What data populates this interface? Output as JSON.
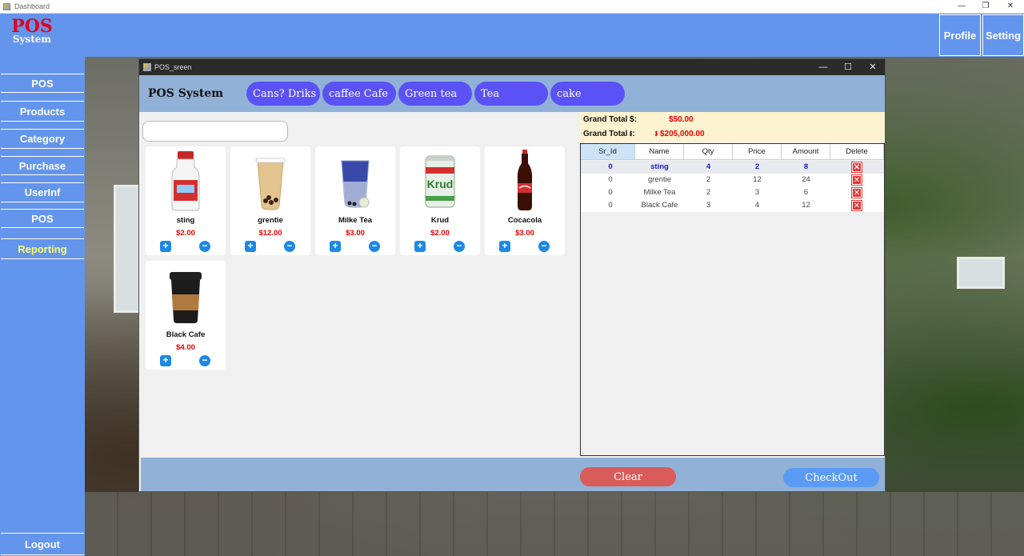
{
  "window": {
    "title": "Dashboard",
    "minimize": "—",
    "restore": "❐",
    "close": "✕"
  },
  "brand": {
    "title": "POS",
    "subtitle": "System"
  },
  "header": {
    "profile": "Profile",
    "setting": "Setting"
  },
  "sidebar": {
    "items": [
      "POS",
      "Products",
      "Category",
      "Purchase",
      "UserInf",
      "POS",
      "Reporting"
    ],
    "logout": "Logout"
  },
  "pos_window": {
    "title": "POS_sreen",
    "minimize": "—",
    "maximize": "☐",
    "close": "✕",
    "heading": "POS System"
  },
  "categories": [
    "Cans? Driks",
    "caffee Cafe",
    "Green tea",
    "Tea",
    "cake"
  ],
  "search": {
    "placeholder": "",
    "value": ""
  },
  "products": [
    {
      "name": "sting",
      "price": "$2.00",
      "icon": "milk-bottle-icon"
    },
    {
      "name": "grentie",
      "price": "$12.00",
      "icon": "bubble-tea-icon"
    },
    {
      "name": "Milke Tea",
      "price": "$3.00",
      "icon": "butterfly-pea-tea-icon"
    },
    {
      "name": "Krud",
      "price": "$2.00",
      "icon": "krud-can-icon"
    },
    {
      "name": "Cocacola",
      "price": "$3.00",
      "icon": "cola-bottle-icon"
    },
    {
      "name": "Black Cafe",
      "price": "$4.00",
      "icon": "coffee-cup-icon"
    }
  ],
  "totals": {
    "usd_label": "Grand Total $:",
    "usd_value": "$50.00",
    "riel_label": "Grand Total ៛:",
    "riel_value": "៛ $205,000.00"
  },
  "cart": {
    "columns": [
      "Sr_Id",
      "Name",
      "Qty",
      "Price",
      "Amount",
      "Delete"
    ],
    "rows": [
      {
        "id": "0",
        "name": "sting",
        "qty": "4",
        "price": "2",
        "amount": "8"
      },
      {
        "id": "0",
        "name": "grentie",
        "qty": "2",
        "price": "12",
        "amount": "24"
      },
      {
        "id": "0",
        "name": "Milke Tea",
        "qty": "2",
        "price": "3",
        "amount": "6"
      },
      {
        "id": "0",
        "name": "Black Cafe",
        "qty": "3",
        "price": "4",
        "amount": "12"
      }
    ],
    "delete_glyph": "✕"
  },
  "actions": {
    "clear": "Clear",
    "checkout": "CheckOut"
  },
  "colors": {
    "accent": "#6495ed",
    "category_button": "#5b52f5",
    "clear": "#d95c5a",
    "checkout": "#5b9bf5",
    "price": "#e00000"
  }
}
